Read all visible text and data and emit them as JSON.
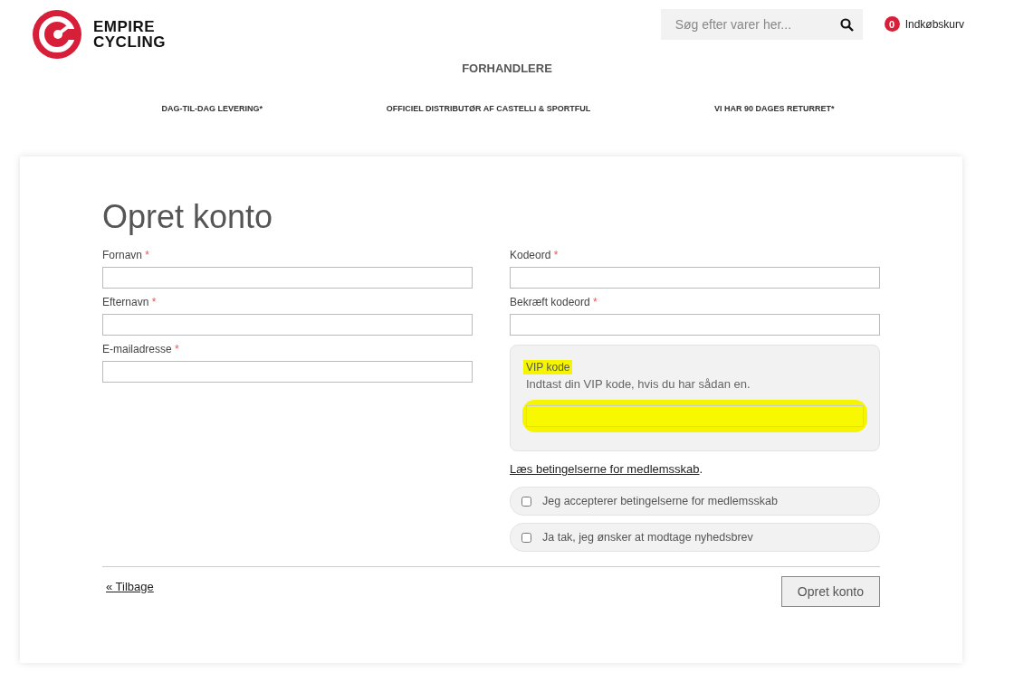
{
  "header": {
    "logo": {
      "line_1": "EMPIRE",
      "line_2": "CYCLING"
    },
    "search": {
      "placeholder": "Søg efter varer her..."
    },
    "cart": {
      "count": "0",
      "label": "Indkøbskurv"
    }
  },
  "nav": {
    "items": [
      "FORHANDLERE"
    ]
  },
  "usps": [
    "DAG-TIL-DAG LEVERING*",
    "OFFICIEL DISTRIBUTØR AF CASTELLI & SPORTFUL",
    "VI HAR 90 DAGES RETURRET*"
  ],
  "form": {
    "title": "Opret konto",
    "left_fields": [
      {
        "label": "Fornavn",
        "required_mark": "*"
      },
      {
        "label": "Efternavn",
        "required_mark": "*"
      },
      {
        "label": "E-mailadresse",
        "required_mark": "*"
      }
    ],
    "right_fields": [
      {
        "label": "Kodeord",
        "required_mark": "*"
      },
      {
        "label": "Bekræft kodeord",
        "required_mark": "*"
      }
    ],
    "vip": {
      "title": "VIP kode",
      "hint": "Indtast din VIP kode, hvis du har sådan en.",
      "highlighted": true
    },
    "terms_link": "Læs betingelserne for medlemsskab",
    "terms_suffix": ".",
    "checkboxes": [
      {
        "label": "Jeg accepterer betingelserne for medlemsskab",
        "checked": false
      },
      {
        "label": "Ja tak, jeg ønsker at modtage nyhedsbrev",
        "checked": false
      }
    ],
    "back_link": "« Tilbage",
    "submit": "Opret konto"
  }
}
